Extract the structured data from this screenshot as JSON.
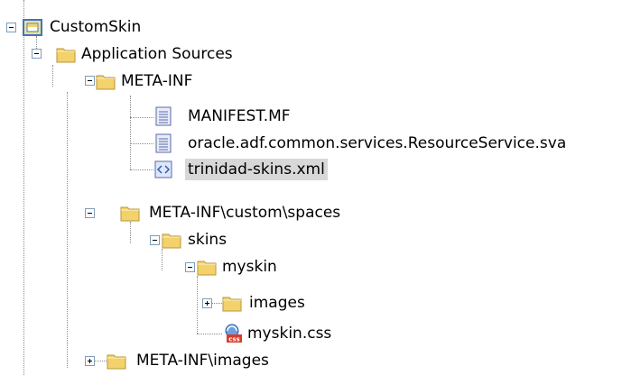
{
  "tree": {
    "root": {
      "label": "CustomSkin",
      "icon": "project-icon",
      "expanded": true
    },
    "nodes": [
      {
        "label": "Application Sources",
        "icon": "folder-icon",
        "expanded": true
      },
      {
        "label": "META-INF",
        "icon": "folder-icon",
        "expanded": true
      },
      {
        "label": "MANIFEST.MF",
        "icon": "text-file-icon"
      },
      {
        "label": "oracle.adf.common.services.ResourceService.sva",
        "icon": "text-file-icon"
      },
      {
        "label": "trinidad-skins.xml",
        "icon": "xml-file-icon",
        "selected": true
      },
      {
        "label": "META-INF\\custom\\spaces",
        "icon": "folder-icon",
        "expanded": true
      },
      {
        "label": "skins",
        "icon": "folder-icon",
        "expanded": true
      },
      {
        "label": "myskin",
        "icon": "folder-icon",
        "expanded": true
      },
      {
        "label": "images",
        "icon": "folder-icon",
        "expanded": false
      },
      {
        "label": "myskin.css",
        "icon": "css-file-icon"
      },
      {
        "label": "META-INF\\images",
        "icon": "folder-icon",
        "expanded": false
      }
    ]
  },
  "colors": {
    "folder": "#f3d26b",
    "selection": "#d8d8d8",
    "css_badge": "#d93b2b"
  }
}
